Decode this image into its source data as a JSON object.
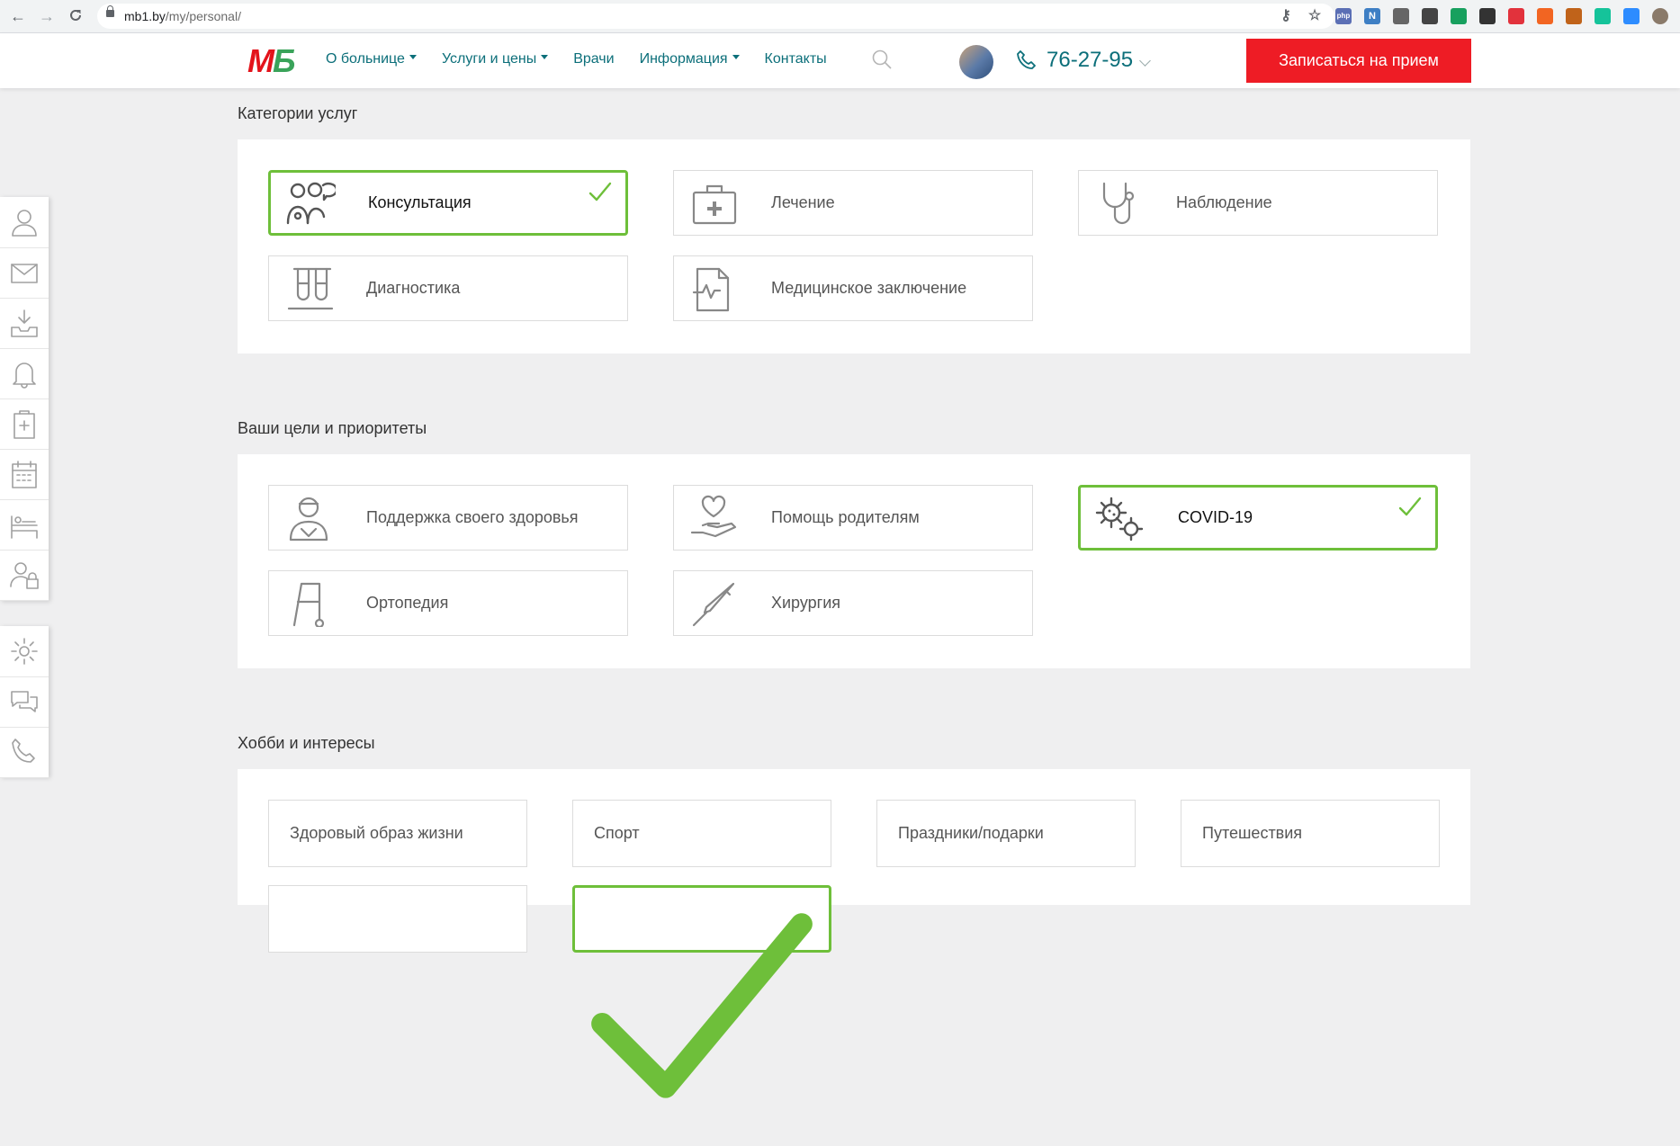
{
  "browser": {
    "url_host": "mb1.by",
    "url_path": "/my/personal/",
    "back_glyph": "←",
    "forward_glyph": "→",
    "reload_glyph": "C",
    "extensions": [
      {
        "name": "key-icon",
        "color": "#5f6368",
        "text": ""
      },
      {
        "name": "star-icon",
        "color": "#5f6368",
        "text": ""
      },
      {
        "name": "php-extension-icon",
        "color": "#5b6fb5",
        "text": "php"
      },
      {
        "name": "n-extension-icon",
        "color": "#3e7fc4",
        "text": "N"
      },
      {
        "name": "globe-extension-icon",
        "color": "#666",
        "text": ""
      },
      {
        "name": "pen-extension-icon",
        "color": "#444",
        "text": ""
      },
      {
        "name": "green-arrow-extension-icon",
        "color": "#18a05e",
        "text": ""
      },
      {
        "name": "bolt-extension-icon",
        "color": "#333",
        "text": ""
      },
      {
        "name": "shield-extension-icon",
        "color": "#e2323c",
        "text": ""
      },
      {
        "name": "hand-extension-icon",
        "color": "#f26522",
        "text": ""
      },
      {
        "name": "tool-extension-icon",
        "color": "#c0631a",
        "text": ""
      },
      {
        "name": "grammarly-extension-icon",
        "color": "#15c39a",
        "text": ""
      },
      {
        "name": "zoom-extension-icon",
        "color": "#2d8cff",
        "text": ""
      },
      {
        "name": "profile-avatar-icon",
        "color": "#8a7a6a",
        "text": ""
      }
    ]
  },
  "header": {
    "logo_left": "М",
    "logo_right": "Б",
    "nav": [
      {
        "label": "О больнице",
        "has_caret": true
      },
      {
        "label": "Услуги и цены",
        "has_caret": true
      },
      {
        "label": "Врачи",
        "has_caret": false
      },
      {
        "label": "Информация",
        "has_caret": true
      },
      {
        "label": "Контакты",
        "has_caret": false
      }
    ],
    "phone": "76-27-95",
    "cta_label": "Записаться на прием"
  },
  "sidebar": {
    "group1": [
      "profile-icon",
      "mail-icon",
      "inbox-download-icon",
      "bell-icon",
      "medical-clipboard-icon",
      "calendar-icon",
      "hospital-bed-icon",
      "user-lock-icon"
    ],
    "group2": [
      "settings-gear-icon",
      "chat-icon",
      "phone-icon"
    ]
  },
  "sections": {
    "categories": {
      "title": "Категории услуг",
      "cards": [
        {
          "label": "Консультация",
          "selected": true,
          "icon": "doctors-consultation-icon"
        },
        {
          "label": "Лечение",
          "selected": false,
          "icon": "first-aid-kit-icon"
        },
        {
          "label": "Наблюдение",
          "selected": false,
          "icon": "stethoscope-icon"
        },
        {
          "label": "Диагностика",
          "selected": false,
          "icon": "test-tubes-icon"
        },
        {
          "label": "Медицинское заключение",
          "selected": false,
          "icon": "medical-document-icon"
        }
      ]
    },
    "goals": {
      "title": "Ваши цели и приоритеты",
      "cards": [
        {
          "label": "Поддержка своего здоровья",
          "selected": false,
          "icon": "nurse-icon"
        },
        {
          "label": "Помощь родителям",
          "selected": false,
          "icon": "heart-hand-icon"
        },
        {
          "label": "COVID-19",
          "selected": true,
          "icon": "virus-icon"
        },
        {
          "label": "Ортопедия",
          "selected": false,
          "icon": "walker-icon"
        },
        {
          "label": "Хирургия",
          "selected": false,
          "icon": "scalpel-icon"
        }
      ]
    },
    "hobbies": {
      "title": "Хобби и интересы",
      "items": [
        {
          "label": "Здоровый образ жизни",
          "selected": false
        },
        {
          "label": "Спорт",
          "selected": false
        },
        {
          "label": "Праздники/подарки",
          "selected": false
        },
        {
          "label": "Путешествия",
          "selected": false
        },
        {
          "label": "",
          "selected": false
        },
        {
          "label": "",
          "selected": true
        }
      ]
    }
  },
  "colors": {
    "accent_teal": "#0c6f7a",
    "cta_red": "#ee1c25",
    "selected_green": "#6ebf3a",
    "page_bg": "#efeff0"
  }
}
